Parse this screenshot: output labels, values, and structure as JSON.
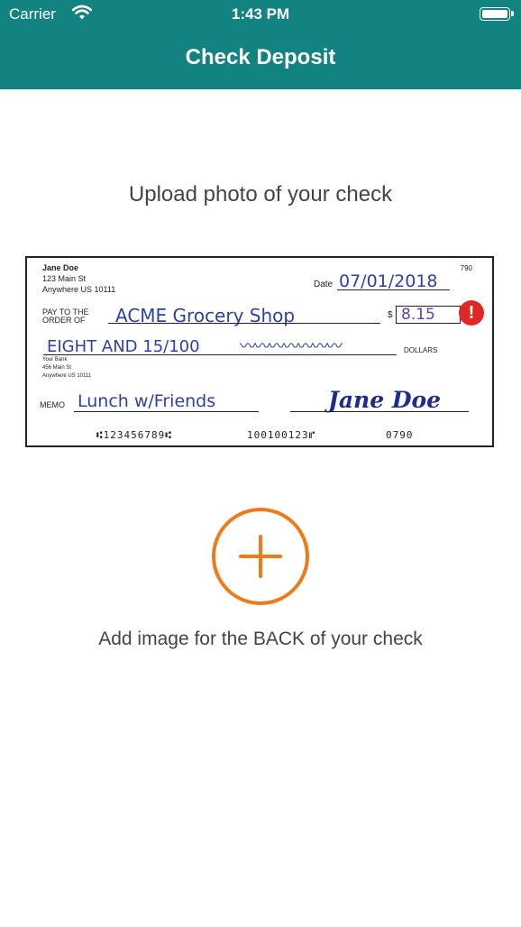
{
  "status_bar": {
    "carrier": "Carrier",
    "time": "1:43 PM",
    "icons": [
      "wifi-icon",
      "battery-icon"
    ]
  },
  "nav": {
    "title": "Check Deposit",
    "background": "#128380"
  },
  "main": {
    "upload_label": "Upload photo of your check",
    "back_label": "Add image for the BACK of your check",
    "accent": "#f07a1a"
  },
  "check": {
    "name": "Jane Doe",
    "address1": "123 Main St",
    "address2": "Anywhere US 10111",
    "number": "790",
    "date_label": "Date",
    "date": "07/01/2018",
    "pay_to_label_1": "PAY TO THE",
    "pay_to_label_2": "ORDER OF",
    "payee": "ACME Grocery Shop",
    "dollar_sign": "$",
    "amount": "8.15",
    "written_amount": "EIGHT AND 15/100",
    "dollars_label": "DOLLARS",
    "bank1": "Your Bank",
    "bank2": "456 Main St",
    "bank3": "Anywhere US 10111",
    "memo_label": "MEMO",
    "memo": "Lunch w/Friends",
    "signature": "Jane Doe",
    "routing": "⑆123456789⑆",
    "account": "100100123⑈",
    "check_no": "0790",
    "warning_icon": "exclamation-icon",
    "warning_color": "#e02727"
  }
}
